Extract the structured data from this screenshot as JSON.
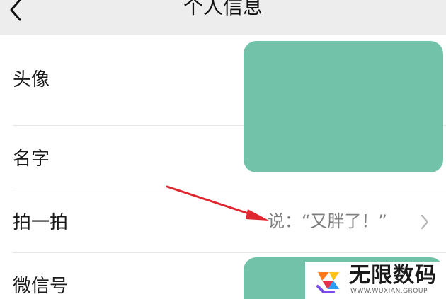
{
  "header": {
    "title": "个人信息",
    "back_icon": "chevron-left-icon"
  },
  "rows": [
    {
      "label": "头像"
    },
    {
      "label": "名字"
    },
    {
      "label": "拍一拍",
      "value": "说：“又胖了！”",
      "chevron_icon": "chevron-right-icon"
    },
    {
      "label": "微信号"
    }
  ],
  "colors": {
    "header_bg": "#ededed",
    "redaction": "#72c2a9",
    "arrow": "#e0262e",
    "value_text": "#7f7f7f"
  },
  "watermark": {
    "brand": "无限数码",
    "url": "WWW.WUXIAN.GROUP",
    "logo_icon": "wuxian-logo-icon"
  }
}
